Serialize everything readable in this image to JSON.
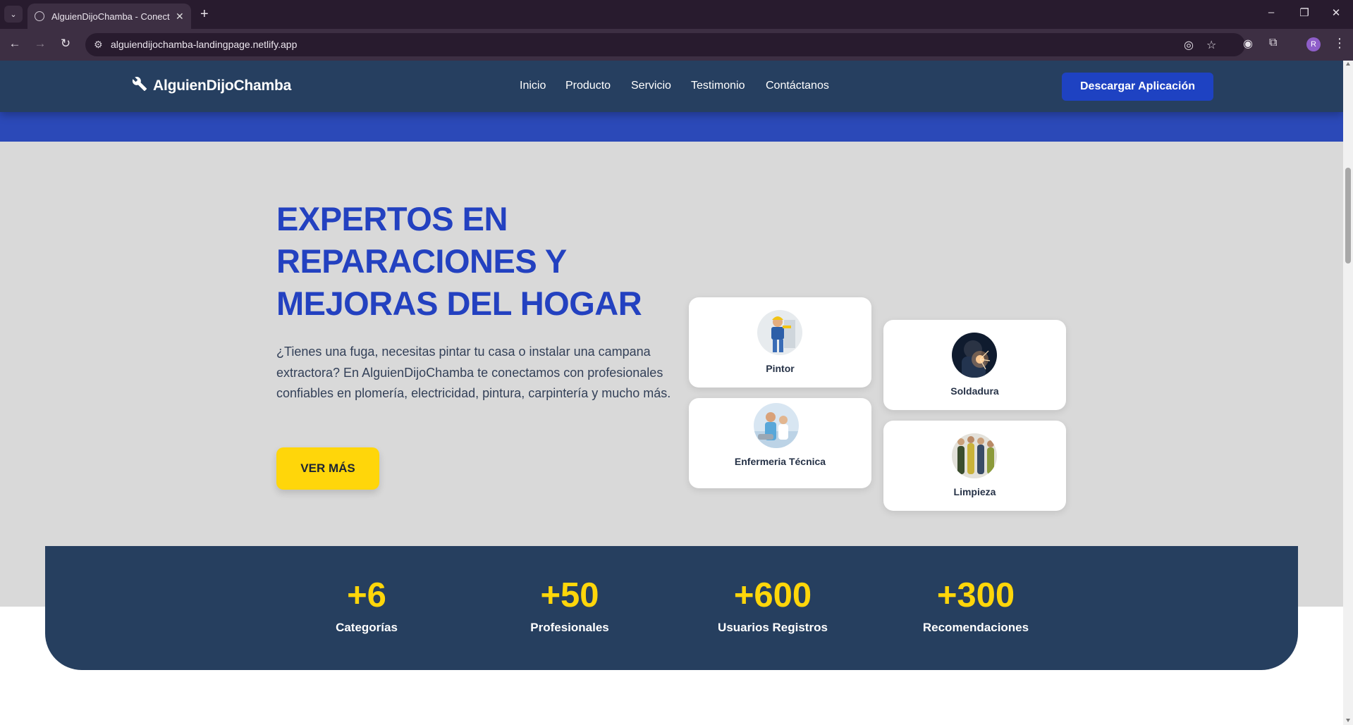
{
  "browser": {
    "tab_title": "AlguienDijoChamba - Conectamos",
    "url": "alguiendijochamba-landingpage.netlify.app",
    "profile_initial": "R"
  },
  "site": {
    "logo_text": "AlguienDijoChamba",
    "nav": [
      "Inicio",
      "Producto",
      "Servicio",
      "Testimonio",
      "Contáctanos"
    ],
    "cta_label": "Descargar Aplicación"
  },
  "hero": {
    "title": "EXPERTOS EN REPARACIONES Y MEJORAS DEL HOGAR",
    "description": "¿Tienes una fuga, necesitas pintar tu casa o instalar una campana extractora? En AlguienDijoChamba te conectamos con profesionales confiables en plomería, electricidad, pintura, carpintería y mucho más.",
    "button_label": "VER MÁS"
  },
  "services": [
    {
      "label": "Pintor"
    },
    {
      "label": "Soldadura"
    },
    {
      "label": "Enfermeria Técnica"
    },
    {
      "label": "Limpieza"
    }
  ],
  "stats": [
    {
      "value": "+6",
      "label": "Categorías"
    },
    {
      "value": "+50",
      "label": "Profesionales"
    },
    {
      "value": "+600",
      "label": "Usuarios Registros"
    },
    {
      "value": "+300",
      "label": "Recomendaciones"
    }
  ],
  "colors": {
    "nav_bg": "#263f60",
    "accent_blue": "#2341c0",
    "accent_yellow": "#ffd60a",
    "hero_bg": "#d9d9d9",
    "stats_bg": "#263f5f"
  }
}
